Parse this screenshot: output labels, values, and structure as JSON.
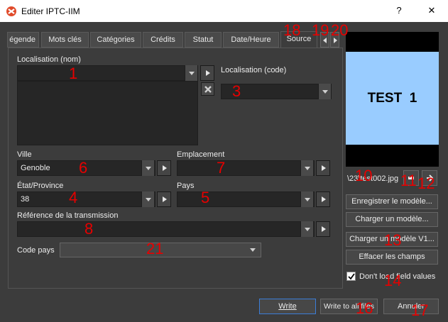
{
  "window": {
    "title": "Editer IPTC-IIM",
    "help_glyph": "?",
    "close_glyph": "✕"
  },
  "tabs": [
    {
      "label": "égende"
    },
    {
      "label": "Mots clés"
    },
    {
      "label": "Catégories"
    },
    {
      "label": "Crédits"
    },
    {
      "label": "Statut"
    },
    {
      "label": "Date/Heure"
    },
    {
      "label": "Source",
      "active": true
    }
  ],
  "form": {
    "localisation_nom_label": "Localisation (nom)",
    "localisation_nom_value": "",
    "localisation_code_label": "Localisation (code)",
    "localisation_code_value": "",
    "ville_label": "Ville",
    "ville_value": "Genoble",
    "emplacement_label": "Emplacement",
    "emplacement_value": "",
    "etat_label": "État/Province",
    "etat_value": "38",
    "pays_label": "Pays",
    "pays_value": "",
    "reference_label": "Référence de la transmission",
    "reference_value": "",
    "code_pays_label": "Code pays",
    "code_pays_value": ""
  },
  "preview": {
    "text": "TEST  1",
    "filename": "\\23\\test002.jpg"
  },
  "side_buttons": {
    "save_template": "Enregistrer le modèle...",
    "load_template": "Charger un modèle...",
    "load_template_v1": "Charger un modèle V1...",
    "clear_fields": "Effacer les champs",
    "dont_load_label": "Don't load field values"
  },
  "dont_load_checked": true,
  "footer": {
    "write": "Write",
    "write_all": "Write to all files",
    "cancel": "Annuler"
  },
  "annotations": [
    "1",
    "3",
    "4",
    "5",
    "6",
    "7",
    "8",
    "10",
    "11",
    "12",
    "13",
    "14",
    "16",
    "17",
    "18",
    "19",
    "20",
    "21"
  ],
  "colors": {
    "background": "#3c3c3c",
    "field": "#262626",
    "preview": "#99ccff",
    "annotation": "#e60000"
  },
  "icons": [
    "app-icon",
    "dropdown-arrow-icon",
    "play-arrow-icon",
    "clear-x-icon",
    "tab-left-arrow-icon",
    "tab-right-arrow-icon",
    "prev-file-icon",
    "next-file-icon",
    "checkmark-icon"
  ]
}
